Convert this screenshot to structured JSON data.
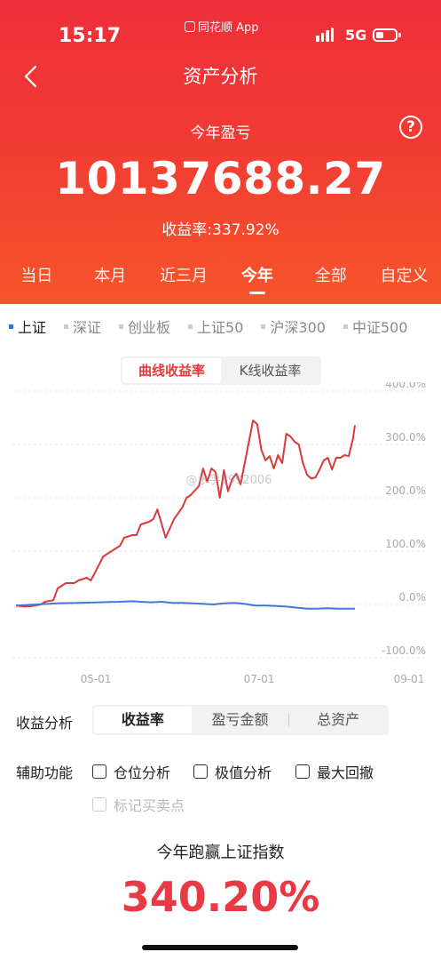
{
  "status": {
    "time": "15:17",
    "app_name": "同花顺 App",
    "network": "5G"
  },
  "header": {
    "title": "资产分析",
    "subtitle": "今年盈亏",
    "total_value": "10137688.27",
    "yield_text": "收益率:337.92%",
    "help_symbol": "?"
  },
  "periods": [
    {
      "label": "当日",
      "active": false
    },
    {
      "label": "本月",
      "active": false
    },
    {
      "label": "近三月",
      "active": false
    },
    {
      "label": "今年",
      "active": true
    },
    {
      "label": "全部",
      "active": false
    },
    {
      "label": "自定义",
      "active": false
    }
  ],
  "index_tabs": [
    {
      "label": "上证",
      "active": true
    },
    {
      "label": "深证",
      "active": false
    },
    {
      "label": "创业板",
      "active": false
    },
    {
      "label": "上证50",
      "active": false
    },
    {
      "label": "沪深300",
      "active": false
    },
    {
      "label": "中证500",
      "active": false
    }
  ],
  "chart_modes": [
    {
      "label": "曲线收益率",
      "active": true
    },
    {
      "label": "K线收益率",
      "active": false
    }
  ],
  "watermark": "@水手1992006",
  "chart_data": {
    "type": "line",
    "y_ticks": [
      "400.0%",
      "300.0%",
      "200.0%",
      "100.0%",
      "0.0%",
      "-100.0%"
    ],
    "x_ticks": [
      "05-01",
      "07-01",
      "09-01"
    ],
    "ylim": [
      -100,
      400
    ],
    "grid": true,
    "series": [
      {
        "color": "#d93a3a",
        "points": [
          [
            0,
            -2
          ],
          [
            4,
            -4
          ],
          [
            8,
            -3
          ],
          [
            12,
            0
          ],
          [
            14,
            5
          ],
          [
            18,
            8
          ],
          [
            20,
            30
          ],
          [
            24,
            40
          ],
          [
            28,
            40
          ],
          [
            30,
            45
          ],
          [
            34,
            50
          ],
          [
            36,
            45
          ],
          [
            38,
            60
          ],
          [
            42,
            90
          ],
          [
            46,
            100
          ],
          [
            50,
            110
          ],
          [
            52,
            125
          ],
          [
            56,
            130
          ],
          [
            58,
            130
          ],
          [
            60,
            150
          ],
          [
            64,
            155
          ],
          [
            66,
            160
          ],
          [
            68,
            178
          ],
          [
            72,
            125
          ],
          [
            76,
            160
          ],
          [
            80,
            182
          ],
          [
            82,
            200
          ],
          [
            84,
            205
          ],
          [
            88,
            222
          ],
          [
            90,
            255
          ],
          [
            92,
            230
          ],
          [
            94,
            255
          ],
          [
            96,
            248
          ],
          [
            98,
            200
          ],
          [
            100,
            252
          ],
          [
            102,
            212
          ],
          [
            104,
            235
          ],
          [
            106,
            245
          ],
          [
            108,
            225
          ],
          [
            110,
            265
          ],
          [
            112,
            305
          ],
          [
            114,
            345
          ],
          [
            116,
            338
          ],
          [
            118,
            290
          ],
          [
            120,
            270
          ],
          [
            122,
            278
          ],
          [
            124,
            255
          ],
          [
            126,
            280
          ],
          [
            128,
            265
          ],
          [
            130,
            320
          ],
          [
            132,
            315
          ],
          [
            134,
            305
          ],
          [
            136,
            300
          ],
          [
            138,
            265
          ],
          [
            140,
            243
          ],
          [
            142,
            236
          ],
          [
            144,
            238
          ],
          [
            146,
            253
          ],
          [
            148,
            270
          ],
          [
            150,
            275
          ],
          [
            152,
            253
          ],
          [
            154,
            275
          ],
          [
            156,
            275
          ],
          [
            158,
            280
          ],
          [
            160,
            278
          ],
          [
            162,
            310
          ],
          [
            163,
            336
          ]
        ]
      },
      {
        "color": "#3f7ad8",
        "points": [
          [
            0,
            -2
          ],
          [
            10,
            0
          ],
          [
            20,
            2
          ],
          [
            30,
            3
          ],
          [
            40,
            4
          ],
          [
            50,
            5
          ],
          [
            56,
            6
          ],
          [
            60,
            5
          ],
          [
            65,
            4
          ],
          [
            70,
            5
          ],
          [
            75,
            3
          ],
          [
            80,
            3
          ],
          [
            85,
            2
          ],
          [
            90,
            1
          ],
          [
            95,
            0
          ],
          [
            100,
            2
          ],
          [
            105,
            3
          ],
          [
            110,
            1
          ],
          [
            115,
            -2
          ],
          [
            120,
            -2
          ],
          [
            125,
            -3
          ],
          [
            130,
            -4
          ],
          [
            135,
            -6
          ],
          [
            140,
            -8
          ],
          [
            145,
            -8
          ],
          [
            150,
            -7
          ],
          [
            155,
            -8
          ],
          [
            160,
            -8
          ],
          [
            163,
            -8
          ]
        ]
      }
    ]
  },
  "analysis": {
    "label": "收益分析",
    "options": [
      {
        "label": "收益率",
        "active": true
      },
      {
        "label": "盈亏金额",
        "active": false
      },
      {
        "label": "总资产",
        "active": false
      }
    ]
  },
  "aux": {
    "label": "辅助功能",
    "options": [
      "仓位分析",
      "极值分析",
      "最大回撤"
    ],
    "disabled_option": "标记买卖点"
  },
  "beat": {
    "title": "今年跑赢上证指数",
    "value": "340.20%"
  }
}
